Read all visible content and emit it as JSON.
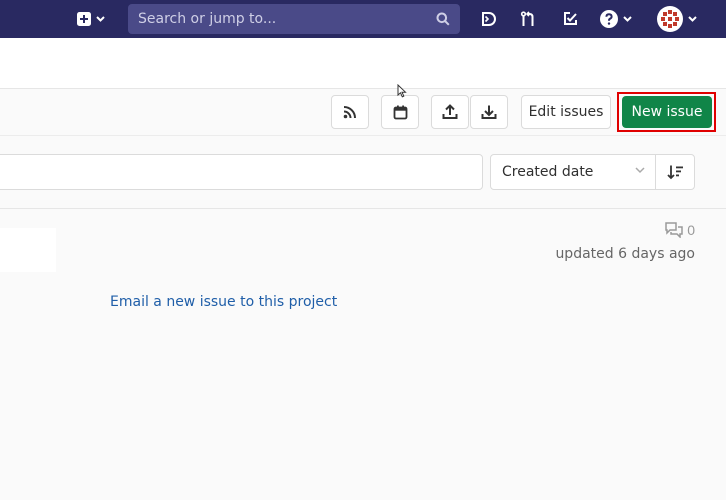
{
  "topbar": {
    "search": {
      "placeholder": "Search or jump to..."
    },
    "icons": [
      "plus-square-icon",
      "chevron-down-icon",
      "search-icon",
      "todo-icon",
      "merge-request-icon",
      "checkbox-icon",
      "help-icon",
      "avatar"
    ],
    "colors": {
      "background": "#292961",
      "search_bg": "#4a4a88"
    }
  },
  "toolbar": {
    "rss_icon": "rss-icon",
    "calendar_icon": "calendar-icon",
    "export_icon": "export-icon",
    "import_icon": "import-icon",
    "edit_issues_label": "Edit issues",
    "new_issue_label": "New issue",
    "colors": {
      "new_issue_bg": "#108548",
      "highlight": "#e00000"
    }
  },
  "filters": {
    "sort_label": "Created date",
    "sort_direction_icon": "sort-descending-icon"
  },
  "issue": {
    "comment_count": "0",
    "updated": "updated 6 days ago"
  },
  "email_link": "Email a new issue to this project",
  "colors": {
    "link": "#1f5ea8",
    "page_bg": "#fafafa"
  }
}
